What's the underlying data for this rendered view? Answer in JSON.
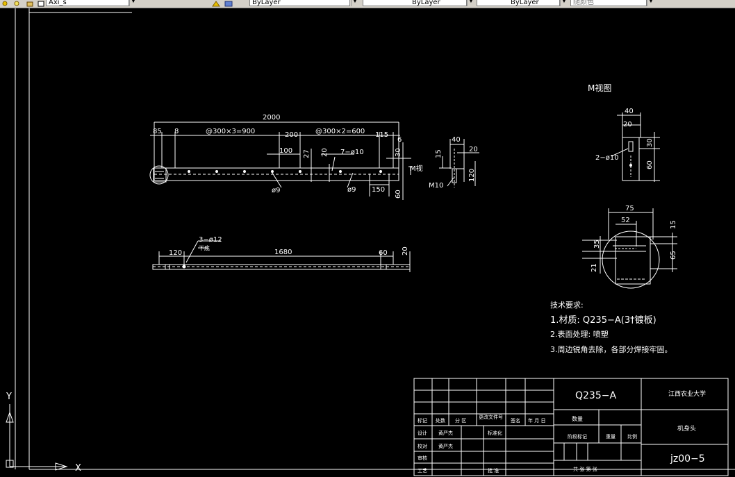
{
  "toolbar": {
    "layer_value": "Axi_s",
    "color_value": "ByLayer",
    "linetype_value": "ByLayer",
    "lineweight_value": "ByLayer",
    "plotstyle_value": "随颜色"
  },
  "drawing": {
    "top_view": {
      "overall": "2000",
      "d85": "85",
      "d8": "8",
      "spacing_left": "@300×3=900",
      "d200": "200",
      "spacing_right": "@300×2=600",
      "d115": "115",
      "d6": "6",
      "d100": "100",
      "d27": "27",
      "d20": "20",
      "holes": "7−ø10",
      "d30": "30",
      "m_view_marker": "M视",
      "d60": "60",
      "d150": "150",
      "phi9_left": "ø9",
      "phi9_right": "ø9"
    },
    "end_view": {
      "d40": "40",
      "d20": "20",
      "d15": "15",
      "d120": "120",
      "thread": "M10"
    },
    "bottom_view": {
      "holes": "3−ø12",
      "note": "下底",
      "d120": "120",
      "d1680": "1680",
      "d60": "60",
      "d20": "20"
    },
    "m_view": {
      "title": "M视图",
      "d40": "40",
      "d20": "20",
      "d30": "30",
      "d60": "60",
      "holes": "2−ø10"
    },
    "circle_view": {
      "d75": "75",
      "d52": "52",
      "d15": "15",
      "d35": "35",
      "d65": "65",
      "d21": "21"
    },
    "notes": {
      "heading": "技术要求:",
      "line1": "1.材质: Q235−A(3†镀板)",
      "line2": "2.表面处理: 喷塑",
      "line3": "3.周边锐角去除，各部分焊接牢固。"
    },
    "ucs": {
      "y_label": "Y",
      "x_label": "X"
    }
  },
  "title_block": {
    "material": "Q235−A",
    "school": "江西农业大学",
    "part_name": "机身头",
    "drawing_no": "jz00−5",
    "stamp": "更改文件号",
    "row_biaoji": "标记",
    "row_chushu": "处数",
    "row_fenqu": "分 区",
    "row_qianming": "签名",
    "row_nyr": "年 月 日",
    "row_sheji": "设计",
    "row_huangmou": "黄严杰",
    "row_biaozhunhua": "标准化",
    "row_jiaodui": "校对",
    "row_huangmou2": "黄严杰",
    "row_shenhe": "审核",
    "row_gongyi": "工艺",
    "row_pizhun": "批 准",
    "label_shuliang": "数量",
    "label_jieduan": "阶段标记",
    "label_zhongliang": "重量",
    "label_bili": "比例",
    "footer": "共 张  第 张"
  }
}
